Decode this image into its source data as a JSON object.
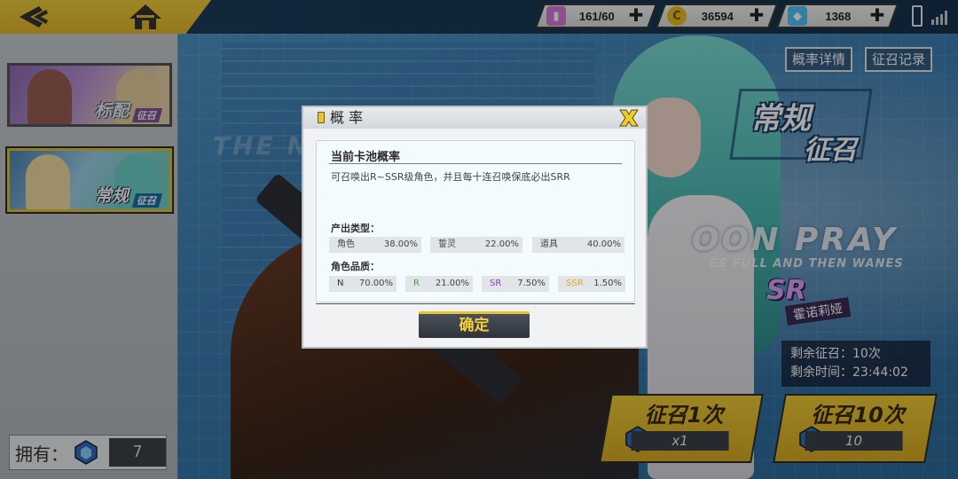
{
  "topbar": {
    "stamina": "161/60",
    "coins": "36594",
    "gems": "1368"
  },
  "sidebar": {
    "banners": [
      {
        "label": "标配",
        "tag": "征召",
        "active": false
      },
      {
        "label": "常规",
        "tag": "征召",
        "active": true
      }
    ],
    "own_label": "拥有：",
    "own_count": "7"
  },
  "main": {
    "rate_detail_button": "概率详情",
    "summon_record_button": "征召记录",
    "pool_title_line1": "常规",
    "pool_title_line2": "征召",
    "bg_text_the": "THE N",
    "bg_text_moon": "OON PRAY",
    "bg_text_sub": "ES FULL AND THEN WANES",
    "character_rarity": "SR",
    "character_name": "霍诺莉娅",
    "remaining_summons": "剩余征召：10次",
    "remaining_time": "剩余时间：23:44:02",
    "summon_single": {
      "label": "征召1次",
      "cost": "x1"
    },
    "summon_ten": {
      "label": "征召10次",
      "cost": "10"
    }
  },
  "modal": {
    "title": "概 率",
    "section_title": "当前卡池概率",
    "description": "可召唤出R~SSR级角色，并且每十连召唤保底必出SRR",
    "output_type_label": "产出类型：",
    "output_types": [
      {
        "name": "角色",
        "rate": "38.00%"
      },
      {
        "name": "誓灵",
        "rate": "22.00%"
      },
      {
        "name": "道具",
        "rate": "40.00%"
      }
    ],
    "quality_label": "角色品质：",
    "qualities": [
      {
        "name": "N",
        "rate": "70.00%",
        "color": "#333333"
      },
      {
        "name": "R",
        "rate": "21.00%",
        "color": "#3aa53a"
      },
      {
        "name": "SR",
        "rate": "7.50%",
        "color": "#8a3cc8"
      },
      {
        "name": "SSR",
        "rate": "1.50%",
        "color": "#e0a52a"
      }
    ],
    "confirm_button": "确定"
  },
  "colors": {
    "accent_yellow": "#e6c22e",
    "dark_panel": "#3b4048",
    "scene_blue": "#3d7fb4"
  },
  "icons": [
    "back-arrow-icon",
    "home-icon",
    "stamina-icon",
    "coin-icon",
    "gem-icon",
    "plus-icon",
    "battery-icon",
    "signal-icon",
    "close-x-icon",
    "summon-ticket-icon"
  ]
}
